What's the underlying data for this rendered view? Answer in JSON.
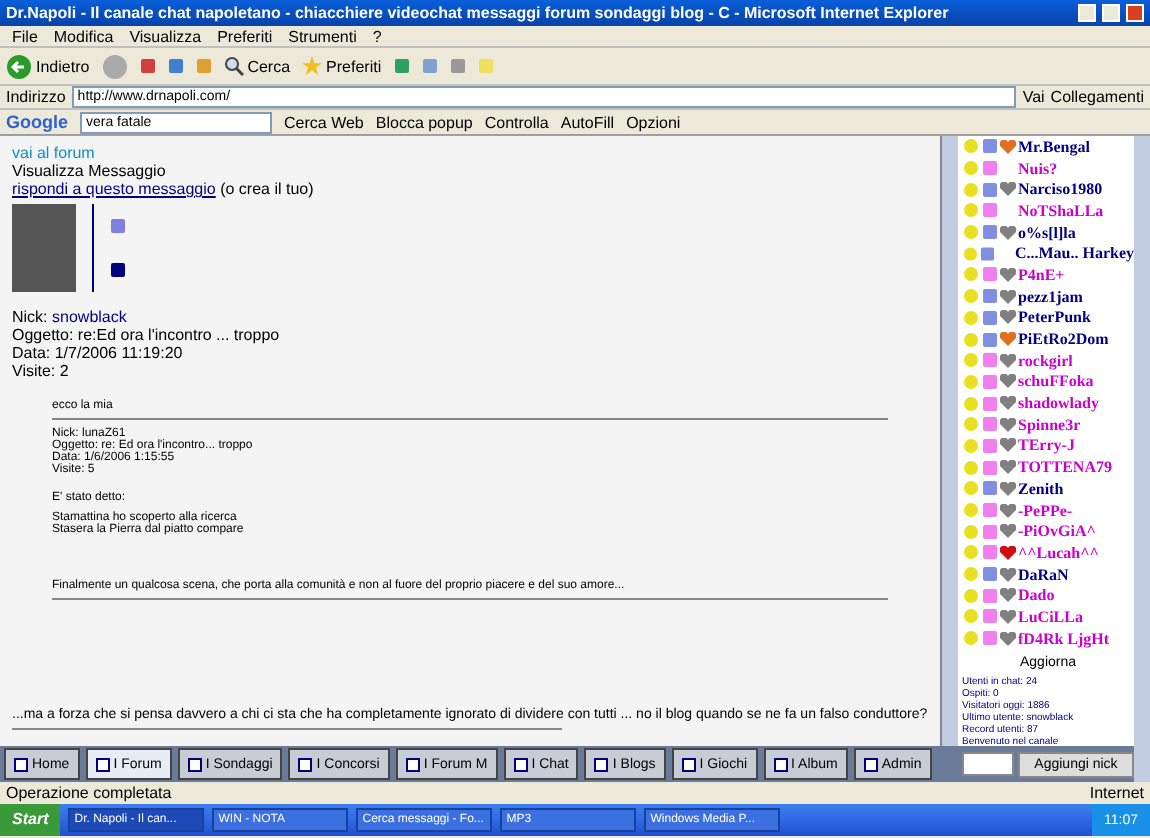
{
  "window": {
    "title": "Dr.Napoli - Il canale chat napoletano - chiacchiere videochat messaggi forum sondaggi blog - C - Microsoft Internet Explorer"
  },
  "menu": [
    "File",
    "Modifica",
    "Visualizza",
    "Preferiti",
    "Strumenti",
    "?"
  ],
  "toolbar": {
    "back": "Indietro",
    "search": "Cerca",
    "favorites": "Preferiti"
  },
  "address": {
    "label": "Indirizzo",
    "value": "http://www.drnapoli.com/",
    "go": "Vai",
    "links": "Collegamenti"
  },
  "google_bar": {
    "logo": "Google",
    "query": "vera fatale",
    "search": "Cerca Web",
    "popup": "Blocca popup",
    "check": "Controlla",
    "autofill": "AutoFill",
    "options": "Opzioni"
  },
  "post": {
    "forum_link": "vai al forum",
    "heading": "Visualizza Messaggio",
    "reply_link": "rispondi a questo messaggio",
    "reply_note": "(o crea il tuo)",
    "nick_label": "Nick:",
    "nick": "snowblack",
    "subject": "Oggetto: re:Ed ora l'incontro ... troppo",
    "date": "Data: 1/7/2006 11:19:20",
    "visits": "Visite: 2",
    "quote_intro": "ecco la mia",
    "quote_lines": [
      "Nick: lunaZ61",
      "Oggetto: re: Ed ora l'incontro... troppo",
      "Data: 1/6/2006 1:15:55",
      "Visite: 5"
    ],
    "said": "E' stato detto:",
    "said_lines": [
      "Stamattina ho scoperto alla ricerca",
      "Stasera la Pierra dal piatto compare"
    ],
    "final": "Finalmente un qualcosa scena, che porta alla comunità e non al fuore del proprio piacere e del suo amore...",
    "footer": "...ma a forza che si pensa davvero a chi ci sta che ha completamente ignorato di dividere con tutti ... no il blog quando se ne fa un falso conduttore?"
  },
  "users": [
    {
      "name": "Mr.Bengal",
      "color": "#000080",
      "kind": "orange-heart"
    },
    {
      "name": "Nuis?",
      "color": "#cc00cc",
      "kind": "plain"
    },
    {
      "name": "Narciso1980",
      "color": "#000080",
      "kind": "grey-heart"
    },
    {
      "name": "NoTShaLLa",
      "color": "#cc00cc",
      "kind": "plain"
    },
    {
      "name": "o%s[l]la",
      "color": "#000080",
      "kind": "grey-heart"
    },
    {
      "name": "C...Mau.. Harkey",
      "color": "#000080",
      "kind": "plain"
    },
    {
      "name": "P4nE+",
      "color": "#cc00cc",
      "kind": "grey-heart"
    },
    {
      "name": "pezz1jam",
      "color": "#000080",
      "kind": "grey-heart"
    },
    {
      "name": "PeterPunk",
      "color": "#000080",
      "kind": "grey-heart"
    },
    {
      "name": "PiEtRo2Dom",
      "color": "#000080",
      "kind": "orange-heart"
    },
    {
      "name": "rockgirl",
      "color": "#cc00cc",
      "kind": "grey-heart"
    },
    {
      "name": "schuFFoka",
      "color": "#cc00cc",
      "kind": "grey-heart"
    },
    {
      "name": "shadowlady",
      "color": "#cc00cc",
      "kind": "grey-heart"
    },
    {
      "name": "Spinne3r",
      "color": "#cc00cc",
      "kind": "grey-heart"
    },
    {
      "name": "TErry-J",
      "color": "#cc00cc",
      "kind": "grey-heart"
    },
    {
      "name": "TOTTENA79",
      "color": "#cc00cc",
      "kind": "grey-heart"
    },
    {
      "name": "Zenith",
      "color": "#000080",
      "kind": "grey-heart"
    },
    {
      "name": "-PePPe-",
      "color": "#cc00cc",
      "kind": "grey-heart"
    },
    {
      "name": "-PiOvGiA^",
      "color": "#cc00cc",
      "kind": "grey-heart"
    },
    {
      "name": "^^Lucah^^",
      "color": "#cc00cc",
      "kind": "red-heart"
    },
    {
      "name": "DaRaN",
      "color": "#000080",
      "kind": "grey-heart"
    },
    {
      "name": "Dado",
      "color": "#cc00cc",
      "kind": "grey-heart"
    },
    {
      "name": "LuCiLLa",
      "color": "#cc00cc",
      "kind": "grey-heart"
    },
    {
      "name": "fD4Rk LjgHt",
      "color": "#cc00cc",
      "kind": "grey-heart"
    }
  ],
  "refresh": "Aggiorna",
  "info_lines": [
    "Utenti in chat: 24",
    "Ospiti: 0",
    "Visitatori oggi: 1886",
    "Ultimo utente: snowblack",
    "Record utenti: 87",
    "Benvenuto nel canale"
  ],
  "add_button": "Aggiungi nick",
  "tabs": [
    {
      "label": "Home",
      "selected": false
    },
    {
      "label": "I Forum",
      "selected": true
    },
    {
      "label": "I Sondaggi",
      "selected": false
    },
    {
      "label": "I Concorsi",
      "selected": false
    },
    {
      "label": "I Forum M",
      "selected": false
    },
    {
      "label": "I Chat",
      "selected": false
    },
    {
      "label": "I Blogs",
      "selected": false
    },
    {
      "label": "I Giochi",
      "selected": false
    },
    {
      "label": "I Album",
      "selected": false
    },
    {
      "label": "Admin",
      "selected": false
    }
  ],
  "status_bar": {
    "text": "Operazione completata",
    "zone": "Internet"
  },
  "taskbar": {
    "start": "Start",
    "items": [
      {
        "label": "Dr. Napoli - Il can...",
        "selected": true
      },
      {
        "label": "WIN - NOTA",
        "selected": false
      },
      {
        "label": "Cerca messaggi - Fo...",
        "selected": false
      },
      {
        "label": "MP3",
        "selected": false
      },
      {
        "label": "Windows Media P...",
        "selected": false
      }
    ],
    "clock": "11:07"
  }
}
